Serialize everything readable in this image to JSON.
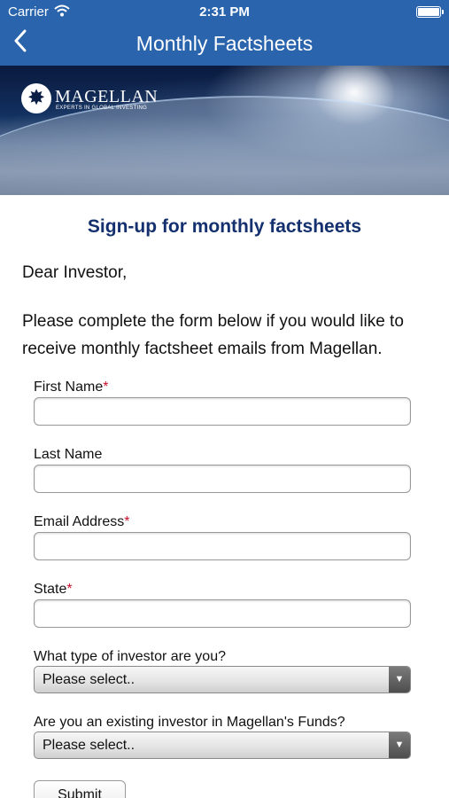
{
  "status_bar": {
    "carrier": "Carrier",
    "time": "2:31 PM",
    "icons": [
      "wifi-icon",
      "battery-icon"
    ]
  },
  "nav": {
    "title": "Monthly Factsheets",
    "back_icon": "chevron-left-icon"
  },
  "hero": {
    "brand_name": "MAGELLAN",
    "tagline": "EXPERTS IN GLOBAL INVESTING",
    "logo_glyph": "✸"
  },
  "page": {
    "heading": "Sign-up for monthly factsheets",
    "greeting": "Dear Investor,",
    "intro": "Please complete the form below if you would like to receive monthly factsheet emails from Magellan."
  },
  "form": {
    "required_marker": "*",
    "first_name": {
      "label": "First Name",
      "value": "",
      "required": true
    },
    "last_name": {
      "label": "Last Name",
      "value": "",
      "required": false
    },
    "email": {
      "label": "Email Address",
      "value": "",
      "required": true
    },
    "state": {
      "label": "State",
      "value": "",
      "required": true
    },
    "investor_type": {
      "label": "What type of investor are you?",
      "selected": "Please select.."
    },
    "existing_investor": {
      "label": "Are you an existing investor in Magellan's Funds?",
      "selected": "Please select.."
    },
    "submit_label": "Submit"
  },
  "colors": {
    "nav_bar": "#2a64ad",
    "heading": "#14306e",
    "required": "#c8102e"
  }
}
